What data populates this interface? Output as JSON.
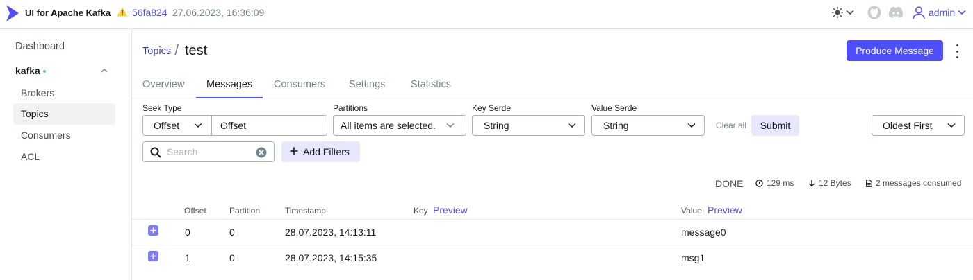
{
  "app": {
    "title": "UI for Apache Kafka",
    "version_hash": "56fa824",
    "version_date": "27.06.2023, 16:36:09",
    "user": "admin",
    "accent_color": "#4f4ffa"
  },
  "sidebar": {
    "dashboard": "Dashboard",
    "cluster": "kafka",
    "cluster_status_color": "#5cd685",
    "items": [
      {
        "label": "Brokers"
      },
      {
        "label": "Topics",
        "active": true
      },
      {
        "label": "Consumers"
      },
      {
        "label": "ACL"
      }
    ]
  },
  "header": {
    "breadcrumb_parent": "Topics",
    "separator": "/",
    "title": "test",
    "produce_button": "Produce Message"
  },
  "tabs": [
    {
      "label": "Overview"
    },
    {
      "label": "Messages",
      "active": true
    },
    {
      "label": "Consumers"
    },
    {
      "label": "Settings"
    },
    {
      "label": "Statistics"
    }
  ],
  "filters": {
    "seek_type_label": "Seek Type",
    "seek_type_value": "Offset",
    "offset_value": "Offset",
    "partitions_label": "Partitions",
    "partitions_value": "All items are selected.",
    "key_serde_label": "Key Serde",
    "key_serde_value": "String",
    "value_serde_label": "Value Serde",
    "value_serde_value": "String",
    "clear_all": "Clear all",
    "submit": "Submit",
    "order_value": "Oldest First",
    "search_placeholder": "Search",
    "add_filters": "Add Filters"
  },
  "status": {
    "state": "DONE",
    "elapsed": "129 ms",
    "bytes": "12 Bytes",
    "consumed": "2 messages consumed"
  },
  "table": {
    "columns": {
      "offset": "Offset",
      "partition": "Partition",
      "timestamp": "Timestamp",
      "key": "Key",
      "key_preview": "Preview",
      "value": "Value",
      "value_preview": "Preview"
    },
    "rows": [
      {
        "offset": "0",
        "partition": "0",
        "timestamp": "28.07.2023, 14:13:11",
        "key": "",
        "value": "message0"
      },
      {
        "offset": "1",
        "partition": "0",
        "timestamp": "28.07.2023, 14:15:35",
        "key": "",
        "value": "msg1"
      }
    ]
  }
}
